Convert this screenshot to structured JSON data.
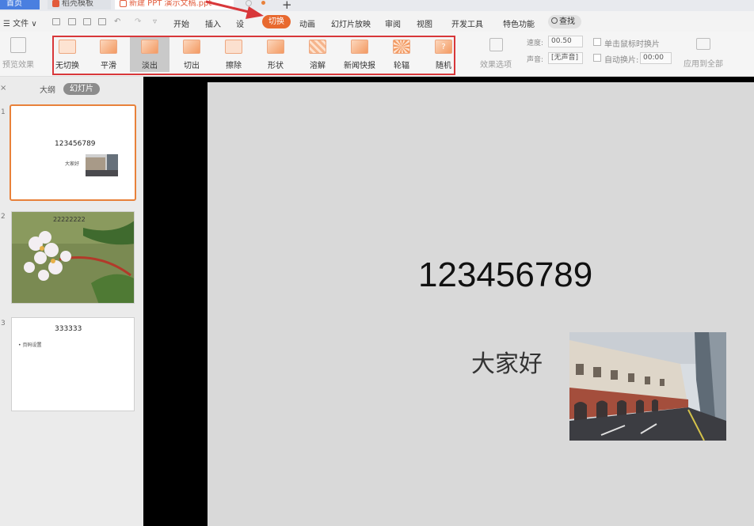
{
  "titlebar": {
    "home_tab": "首页",
    "templates_tab": "稻壳模板",
    "document_tab": "新建 PPT 演示文稿.ppt",
    "new_tab_glyph": "+"
  },
  "menubar": {
    "file": "☰ 文件 ∨",
    "items": [
      "开始",
      "插入",
      "设",
      "切换",
      "动画",
      "幻灯片放映",
      "审阅",
      "视图",
      "开发工具",
      "特色功能"
    ],
    "active": "切换",
    "search": "查找"
  },
  "ribbon": {
    "preview_effect": "预览效果",
    "transitions": [
      "无切换",
      "平滑",
      "淡出",
      "切出",
      "擦除",
      "形状",
      "溶解",
      "新闻快报",
      "轮辐",
      "随机"
    ],
    "selected_transition": "淡出",
    "effect_options": "效果选项",
    "speed_label": "速度:",
    "speed_value": "00.50",
    "sound_label": "声音:",
    "sound_value": "[无声音]",
    "on_click_label": "单击鼠标时换片",
    "auto_switch_label": "自动换片:",
    "auto_switch_value": "00:00",
    "apply_all": "应用到全部"
  },
  "left_panel": {
    "close_glyph": "×",
    "tab_outline": "大纲",
    "tab_slides": "幻灯片",
    "slides": [
      {
        "number": "1",
        "title": "123456789",
        "subtitle": "大家好"
      },
      {
        "number": "2",
        "title": "22222222"
      },
      {
        "number": "3",
        "title": "333333",
        "bullet": "• 页码设置"
      }
    ]
  },
  "slide": {
    "title": "123456789",
    "subtitle": "大家好"
  },
  "colors": {
    "accent": "#e8692f",
    "annotation_red": "#d8373a",
    "selected_thumb_border": "#e8813a"
  }
}
